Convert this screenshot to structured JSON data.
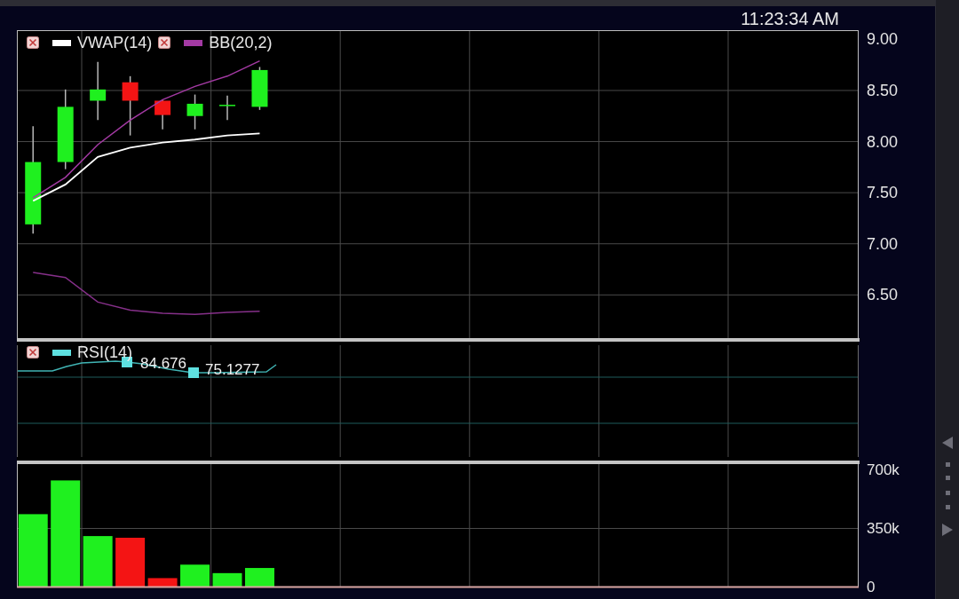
{
  "header": {
    "time": "11:23:34 AM"
  },
  "price_pane": {
    "chart_data": {
      "type": "candlestick",
      "categories": [
        null,
        null,
        null,
        null,
        null,
        null,
        null,
        null,
        null,
        null,
        null,
        null,
        null,
        null,
        null,
        null,
        null,
        null,
        null,
        null,
        null,
        null,
        null,
        null,
        null,
        null
      ],
      "ylim": [
        6.06,
        9.09
      ],
      "grid": true,
      "yticks": [
        {
          "value": 6.5,
          "label": "6.50"
        },
        {
          "value": 7,
          "label": "7.00"
        },
        {
          "value": 7.5,
          "label": "7.50"
        },
        {
          "value": 8,
          "label": "8.00"
        },
        {
          "value": 8.5,
          "label": "8.50"
        },
        {
          "value": 9,
          "label": "9.00"
        }
      ],
      "ohlc": [
        [
          7.19,
          8.15,
          7.1,
          7.8
        ],
        [
          7.8,
          8.51,
          7.73,
          8.34
        ],
        [
          8.4,
          8.78,
          8.21,
          8.51
        ],
        [
          8.58,
          8.64,
          8.06,
          8.4
        ],
        [
          8.4,
          8.41,
          8.12,
          8.26
        ],
        [
          8.25,
          8.46,
          8.12,
          8.37
        ],
        [
          8.36,
          8.45,
          8.21,
          8.36
        ],
        [
          8.34,
          8.73,
          8.31,
          8.7
        ],
        null,
        null,
        null,
        null,
        null,
        null,
        null,
        null,
        null,
        null,
        null,
        null,
        null,
        null,
        null,
        null,
        null,
        null
      ],
      "series": [
        {
          "name": "VWAP(14)",
          "type": "line",
          "color": "#ffffff",
          "values": [
            7.42,
            7.58,
            7.85,
            7.94,
            7.99,
            8.02,
            8.06,
            8.08,
            null,
            null,
            null,
            null,
            null,
            null,
            null,
            null,
            null,
            null,
            null,
            null,
            null,
            null,
            null,
            null,
            null,
            null
          ]
        },
        {
          "name": "BB(20,2)",
          "type": "line",
          "color": "#a43aa4",
          "values": [
            7.45,
            7.65,
            7.97,
            8.21,
            8.41,
            8.54,
            8.64,
            8.79,
            null,
            null,
            null,
            null,
            null,
            null,
            null,
            null,
            null,
            null,
            null,
            null,
            null,
            null,
            null,
            null,
            null,
            null
          ]
        },
        {
          "type": "line",
          "color": "#86308a",
          "values": [
            6.72,
            6.67,
            6.43,
            6.35,
            6.32,
            6.31,
            6.33,
            6.34,
            null,
            null,
            null,
            null,
            null,
            null,
            null,
            null,
            null,
            null,
            null,
            null,
            null,
            null,
            null,
            null,
            null,
            null
          ]
        }
      ]
    }
  },
  "rsi_pane": {
    "legend": "RSI(14)",
    "value_labels": [
      "84.676",
      "75.1277"
    ]
  },
  "volume_pane": {
    "chart_data": {
      "type": "bar",
      "categories": [
        null,
        null,
        null,
        null,
        null,
        null,
        null,
        null,
        null,
        null,
        null,
        null,
        null,
        null,
        null,
        null,
        null,
        null,
        null,
        null,
        null,
        null,
        null,
        null,
        null,
        null
      ],
      "ylim": [
        0,
        748000
      ],
      "grid": true,
      "yticks": [
        {
          "value": 0,
          "label": "0"
        },
        {
          "value": 350000,
          "label": "350k"
        },
        {
          "value": 700000,
          "label": "700k"
        }
      ],
      "values": [
        436000,
        639000,
        304000,
        294000,
        51000,
        132000,
        81000,
        112000,
        null,
        null,
        null,
        null,
        null,
        null,
        null,
        null,
        null,
        null,
        null,
        null,
        null,
        null,
        null,
        null,
        null,
        null
      ]
    }
  }
}
